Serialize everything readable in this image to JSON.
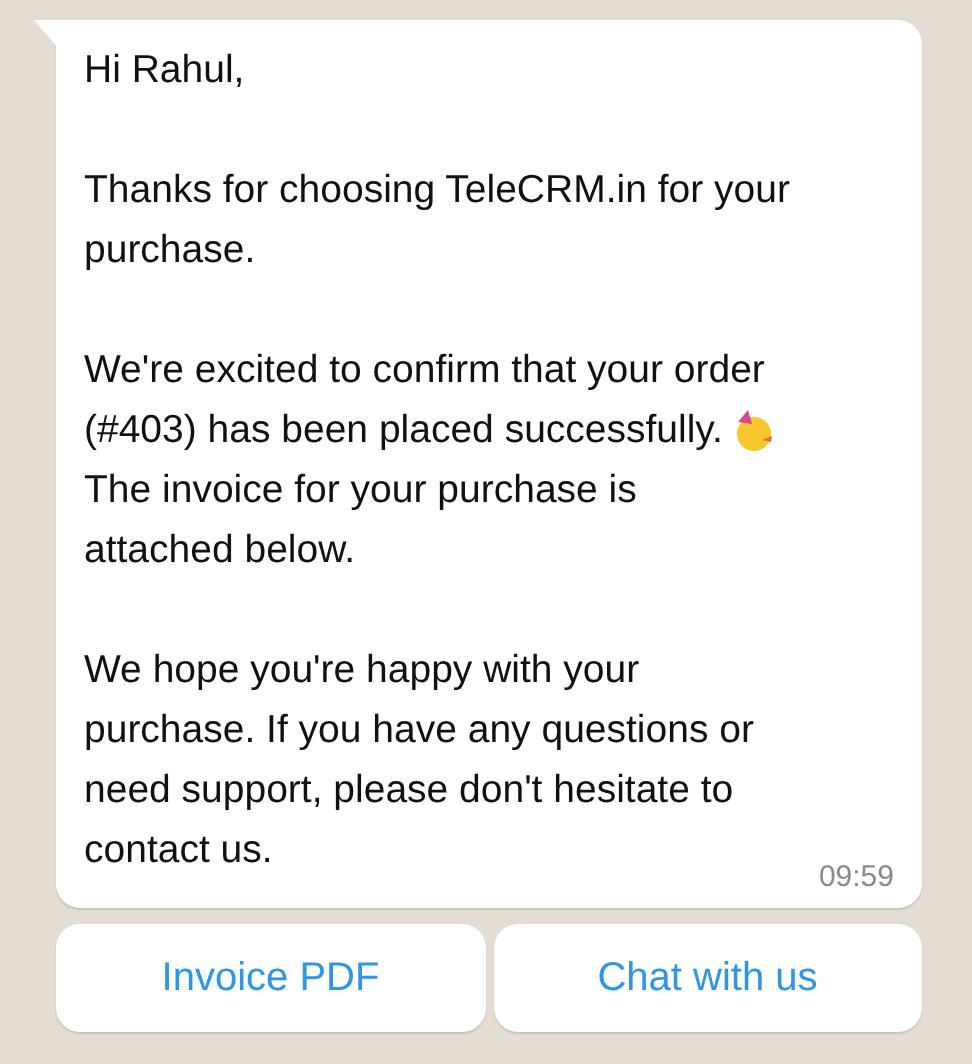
{
  "message": {
    "blocks": [
      [
        {
          "text": "Hi Rahul,"
        }
      ],
      [
        {
          "text": "Thanks for choosing TeleCRM.in for your"
        },
        {
          "text": "purchase."
        }
      ],
      [
        {
          "text": "We're excited to confirm that your order"
        },
        {
          "text": "(#403) has been placed successfully.",
          "kind": "emoji"
        },
        {
          "text": "The invoice for your purchase is"
        },
        {
          "text": "attached below."
        }
      ],
      [
        {
          "text": "We hope you're happy with your"
        },
        {
          "text": "purchase. If you have any questions or"
        },
        {
          "text": "need support, please don't hesitate to"
        },
        {
          "text": "contact us."
        }
      ]
    ],
    "time": "09:59"
  },
  "buttons": [
    {
      "label": "Invoice PDF"
    },
    {
      "label": "Chat with us"
    }
  ]
}
